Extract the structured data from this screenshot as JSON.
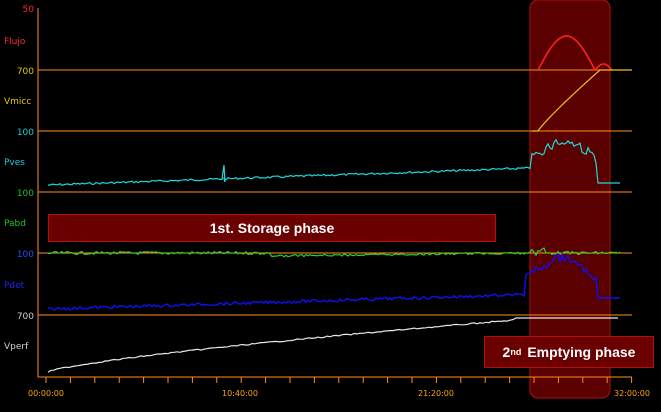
{
  "channels": [
    {
      "id": "flujo",
      "label": "Flujo",
      "scale_label": "50",
      "label_color": "#ff2a2a",
      "scale_color": "#ff2a2a",
      "trace_color": "#ff2020"
    },
    {
      "id": "vmicc",
      "label": "Vmicc",
      "scale_label": "700",
      "label_color": "#e8c800",
      "scale_color": "#e8c800",
      "trace_color": "#f0c020"
    },
    {
      "id": "pves",
      "label": "Pves",
      "scale_label": "100",
      "label_color": "#20c8d8",
      "scale_color": "#20c8d8",
      "trace_color": "#20d8d8"
    },
    {
      "id": "pabd",
      "label": "Pabd",
      "scale_label": "100",
      "label_color": "#20c020",
      "scale_color": "#20c020",
      "trace_color": "#30d030"
    },
    {
      "id": "pdet",
      "label": "Pdet",
      "scale_label": "100",
      "label_color": "#2020ff",
      "scale_color": "#2050ff",
      "trace_color": "#1010ee"
    },
    {
      "id": "vperf",
      "label": "Vperf",
      "scale_label": "700",
      "label_color": "#d0d0d0",
      "scale_color": "#d0d0d0",
      "trace_color": "#e8e8e8"
    }
  ],
  "time_axis": {
    "ticks": [
      "00:00:00",
      "10:40:00",
      "21:20:00",
      "32:00:00"
    ],
    "tick_color": "#ffa500"
  },
  "annotations": {
    "storage_phase": "1st. Storage phase",
    "emptying_phase_sup": "nd",
    "emptying_phase_num": "2",
    "emptying_phase_text": "Emptying phase"
  },
  "colors": {
    "background": "#000000",
    "separator": "#ff8c1a",
    "highlight_fill": "#5a0000",
    "highlight_border": "#b01010"
  }
}
